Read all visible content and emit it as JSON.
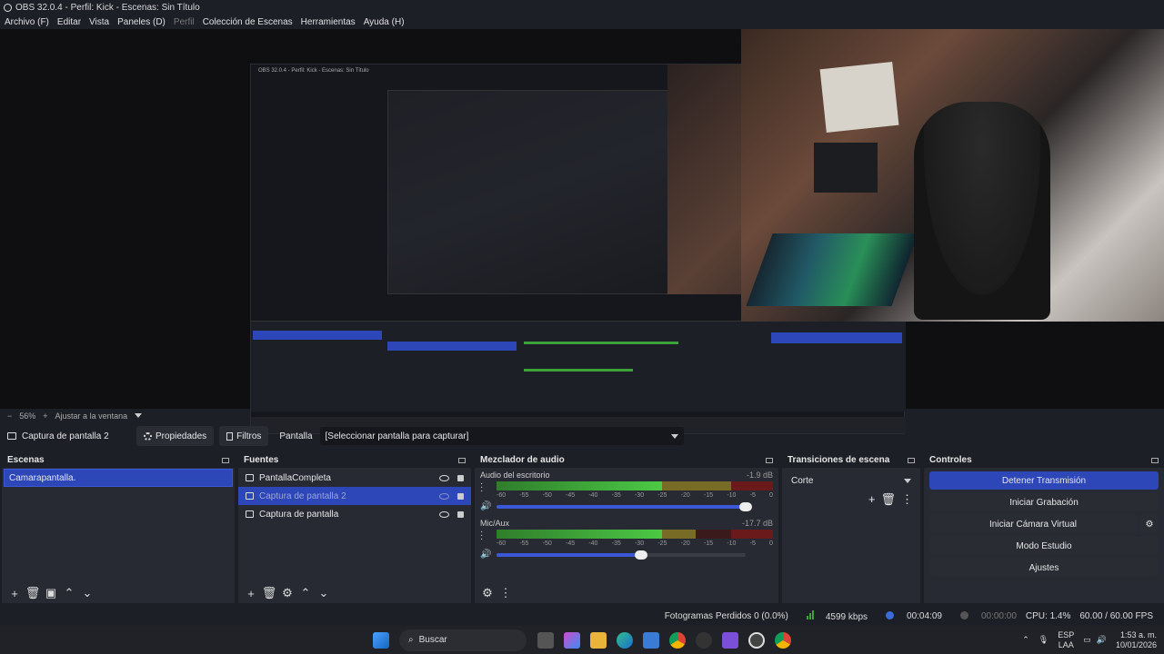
{
  "window": {
    "title": "OBS 32.0.4 - Perfil: Kick - Escenas: Sin Título"
  },
  "menu": [
    "Archivo (F)",
    "Editar",
    "Vista",
    "Paneles (D)",
    "Perfil",
    "Colección de Escenas",
    "Herramientas",
    "Ayuda (H)"
  ],
  "nested_preview": {
    "title": "OBS 32.0.4 - Perfil: Kick - Escenas: Sin Título"
  },
  "zoom": {
    "minus": "−",
    "level": "56%",
    "plus": "+",
    "fit": "Ajustar a la ventana"
  },
  "source_toolbar": {
    "current_source": "Captura de pantalla 2",
    "properties": "Propiedades",
    "filters": "Filtros",
    "display_label": "Pantalla",
    "display_value": "[Seleccionar pantalla para capturar]"
  },
  "scenes": {
    "title": "Escenas",
    "items": [
      "Camarapantalla."
    ]
  },
  "sources": {
    "title": "Fuentes",
    "items": [
      {
        "name": "PantallaCompleta",
        "icon": "camera-icon"
      },
      {
        "name": "Captura de pantalla 2",
        "icon": "monitor-icon"
      },
      {
        "name": "Captura de pantalla",
        "icon": "monitor-icon"
      }
    ]
  },
  "mixer": {
    "title": "Mezclador de audio",
    "ticks": [
      "-60",
      "-55",
      "-50",
      "-45",
      "-40",
      "-35",
      "-30",
      "-25",
      "-20",
      "-15",
      "-10",
      "-5",
      "0"
    ],
    "channels": [
      {
        "name": "Audio del escritorio",
        "db": "-1.9 dB",
        "level": 0.98,
        "volume": 1.0
      },
      {
        "name": "Mic/Aux",
        "db": "-17.7 dB",
        "level": 0.72,
        "volume": 0.58
      }
    ]
  },
  "transitions": {
    "title": "Transiciones de escena",
    "selected": "Corte"
  },
  "controls": {
    "title": "Controles",
    "stop_stream": "Detener Transmisión",
    "start_recording": "Iniciar Grabación",
    "start_vcam": "Iniciar Cámara Virtual",
    "studio_mode": "Modo Estudio",
    "settings": "Ajustes"
  },
  "status": {
    "dropped": "Fotogramas Perdidos 0 (0.0%)",
    "bitrate": "4599 kbps",
    "stream_time": "00:04:09",
    "rec_time": "00:00:00",
    "cpu": "CPU: 1.4%",
    "fps": "60.00 / 60.00 FPS"
  },
  "taskbar": {
    "search_placeholder": "Buscar",
    "lang": "ESP",
    "layout": "LAA",
    "time": "1:53 a. m.",
    "date": "10/01/2026"
  },
  "colors": {
    "accent": "#2d46b8",
    "panel": "#1d1f26",
    "meter_green": "#4cc945"
  }
}
